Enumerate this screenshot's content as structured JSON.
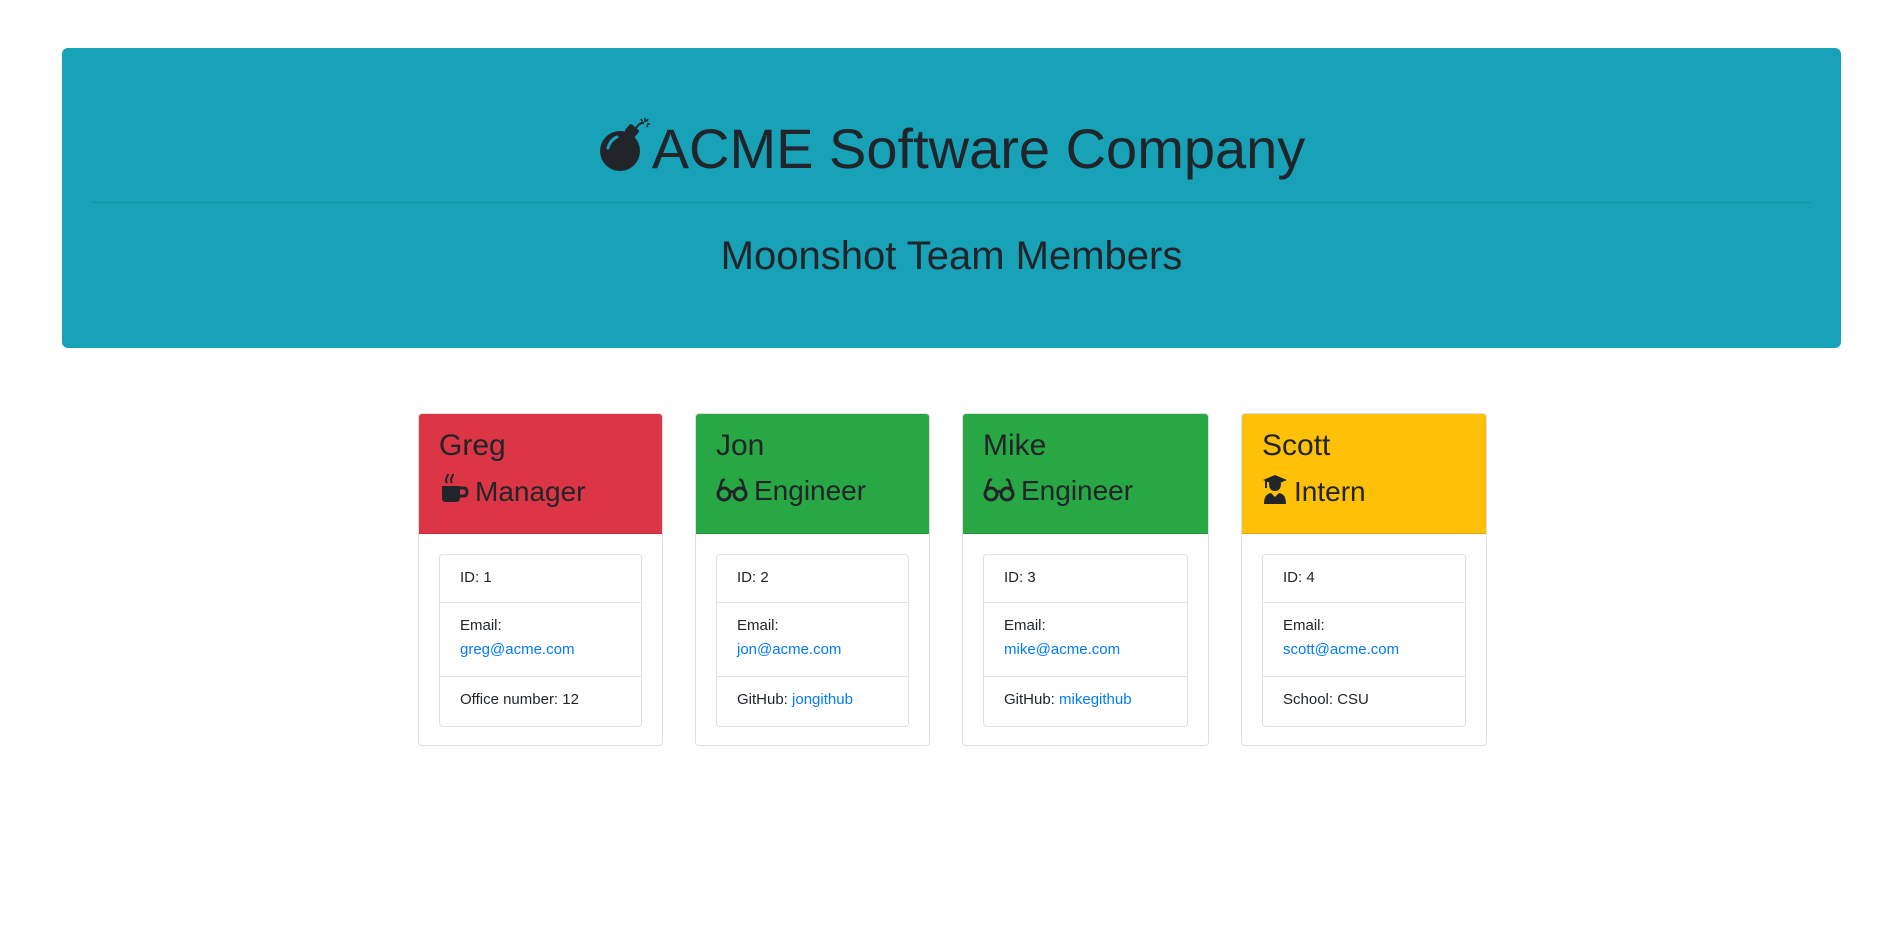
{
  "header": {
    "company_title": "ACME Software Company",
    "team_title": "Moonshot Team Members",
    "logo_icon": "bomb-icon",
    "background_color": "#17a2b8"
  },
  "cards": [
    {
      "name": "Greg",
      "role": "Manager",
      "role_icon": "coffee-icon",
      "header_color": "#dc3545",
      "id_text": "ID: 1",
      "email_label": "Email:",
      "email": "greg@acme.com",
      "extra_label": "Office number: 12",
      "extra_link": ""
    },
    {
      "name": "Jon",
      "role": "Engineer",
      "role_icon": "glasses-icon",
      "header_color": "#28a745",
      "id_text": "ID: 2",
      "email_label": "Email:",
      "email": "jon@acme.com",
      "extra_label": "GitHub: ",
      "extra_link": "jongithub"
    },
    {
      "name": "Mike",
      "role": "Engineer",
      "role_icon": "glasses-icon",
      "header_color": "#28a745",
      "id_text": "ID: 3",
      "email_label": "Email:",
      "email": "mike@acme.com",
      "extra_label": "GitHub: ",
      "extra_link": "mikegithub"
    },
    {
      "name": "Scott",
      "role": "Intern",
      "role_icon": "graduate-icon",
      "header_color": "#ffc107",
      "id_text": "ID: 4",
      "email_label": "Email:",
      "email": "scott@acme.com",
      "extra_label": "School: CSU",
      "extra_link": ""
    }
  ],
  "colors": {
    "link": "#007bff",
    "text": "#212529"
  }
}
